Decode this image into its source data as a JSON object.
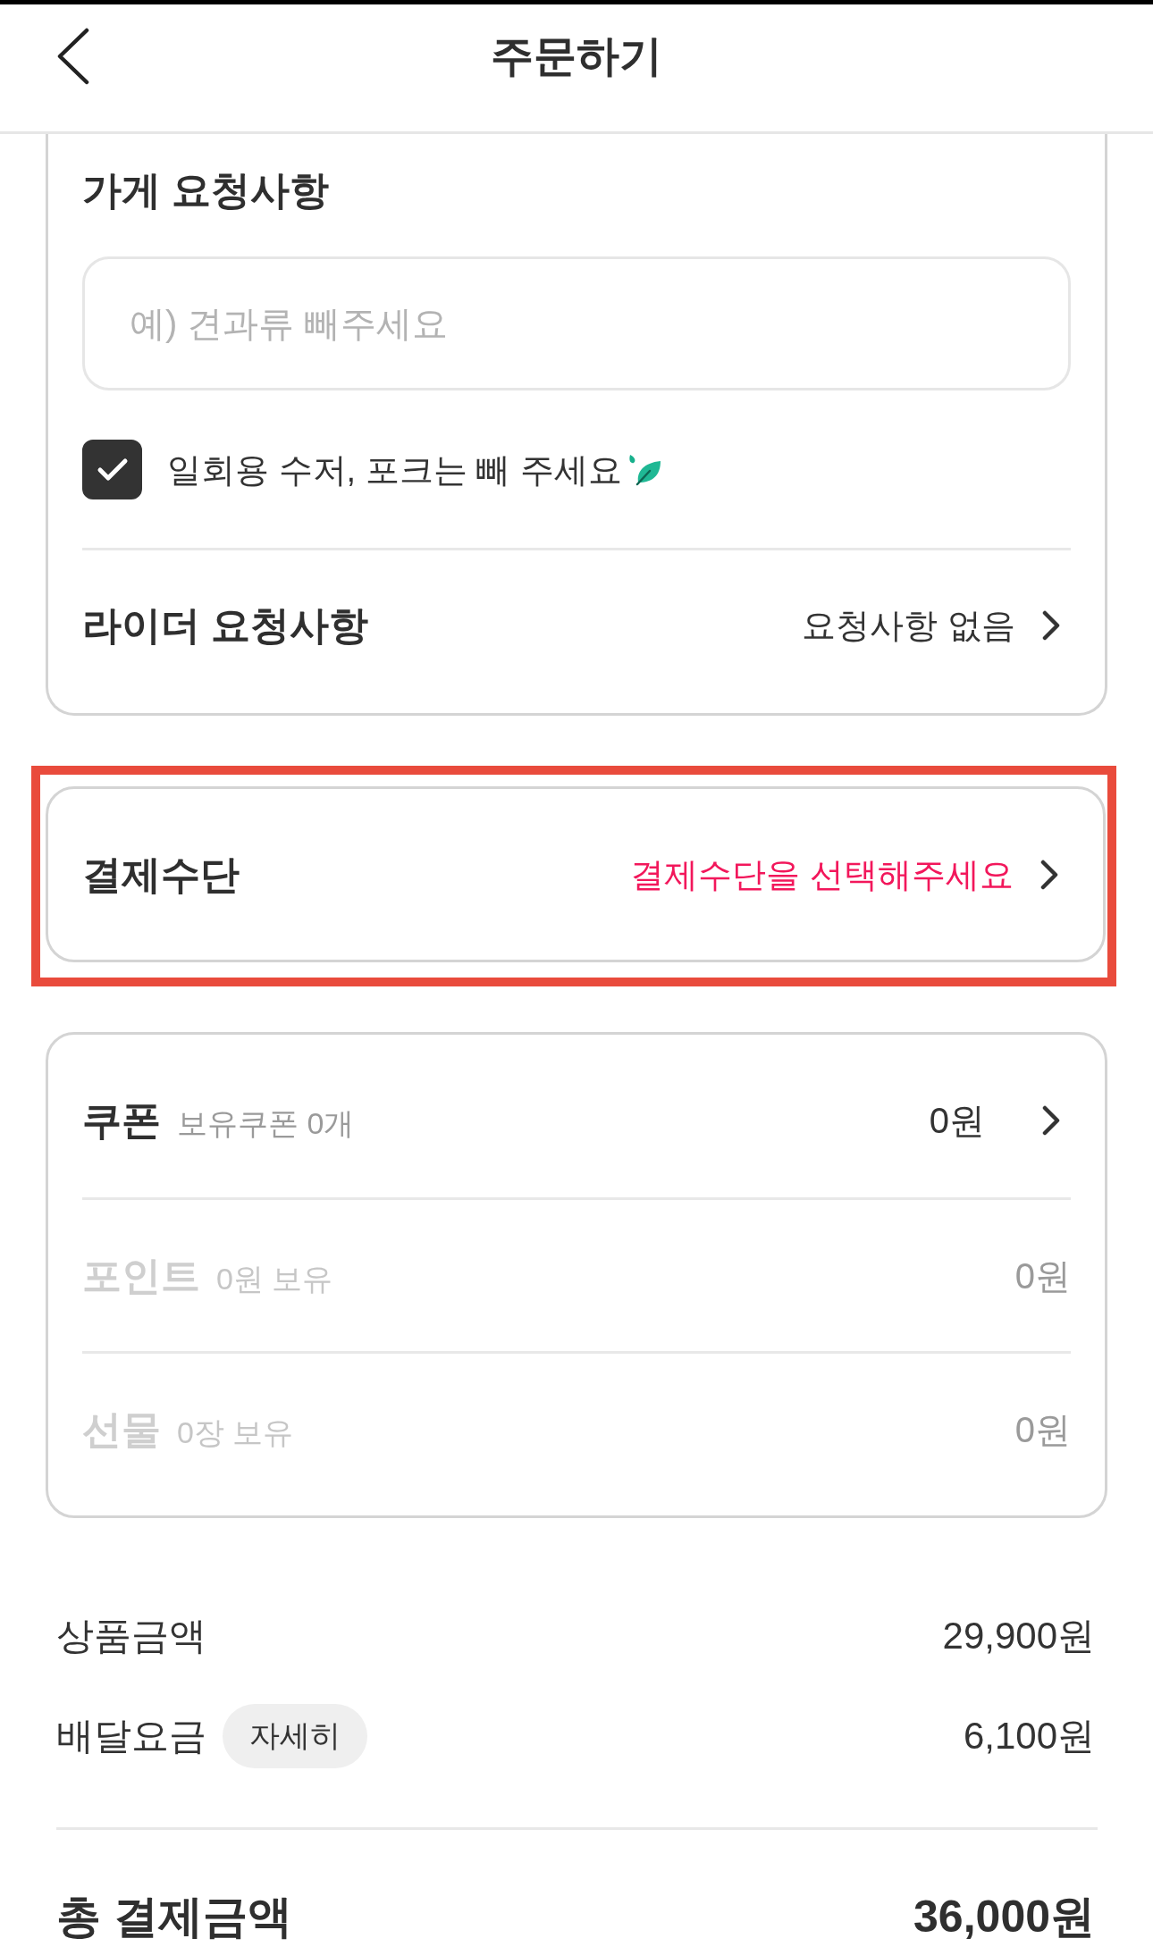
{
  "header": {
    "title": "주문하기"
  },
  "store_request": {
    "title": "가게 요청사항",
    "input": {
      "placeholder": "예) 견과류 빼주세요"
    },
    "option": {
      "label": "일회용 수저, 포크는 빼 주세요",
      "checked": true
    }
  },
  "rider_request": {
    "label": "라이더 요청사항",
    "value": "요청사항 없음"
  },
  "payment_method": {
    "label": "결제수단",
    "value": "결제수단을 선택해주세요",
    "highlighted": true
  },
  "discounts": [
    {
      "label": "쿠폰",
      "detail": "보유쿠폰 0개",
      "value": "0원",
      "disabled": false
    },
    {
      "label": "포인트",
      "detail": "0원 보유",
      "value": "0원",
      "disabled": true
    },
    {
      "label": "선물",
      "detail": "0장 보유",
      "value": "0원",
      "disabled": true
    }
  ],
  "summary": [
    {
      "label": "상품금액",
      "value": "29,900원"
    },
    {
      "label": "배달요금",
      "button": "자세히",
      "value": "6,100원"
    }
  ],
  "total": {
    "label": "총 결제금액",
    "value": "36,000원"
  }
}
